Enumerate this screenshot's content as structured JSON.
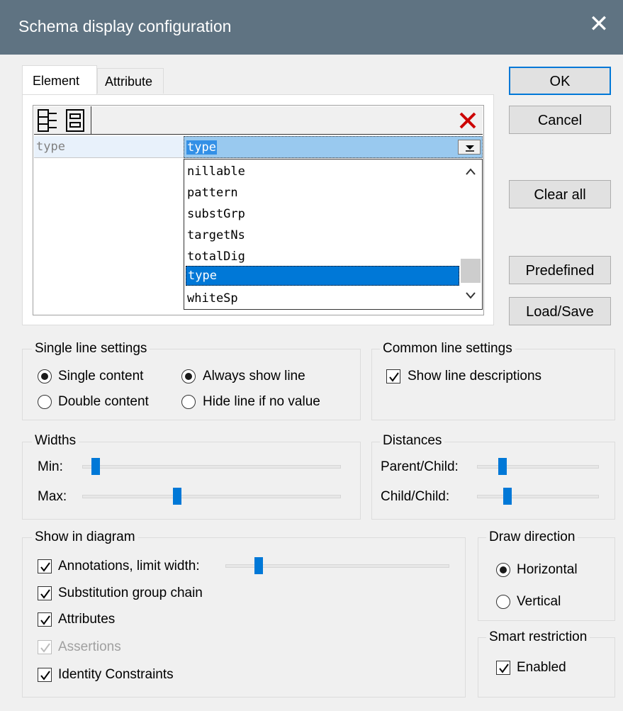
{
  "window": {
    "title": "Schema display configuration",
    "close_glyph": "✕"
  },
  "tabs": [
    {
      "label": "Element",
      "active": true
    },
    {
      "label": "Attribute",
      "active": false
    }
  ],
  "buttons": {
    "ok": "OK",
    "cancel": "Cancel",
    "clear_all": "Clear all",
    "predefined": "Predefined",
    "load_save": "Load/Save"
  },
  "toolbar": {
    "icons": [
      "insert-line-icon",
      "append-line-icon"
    ],
    "delete_icon": "delete-icon",
    "delete_color": "#cc0000"
  },
  "grid": {
    "row_label": "type",
    "combo_value": "type",
    "dropdown_items": [
      "nillable",
      "pattern",
      "substGrp",
      "targetNs",
      "totalDig",
      "type",
      "whiteSp"
    ],
    "selected_index": 5
  },
  "single_line": {
    "title": "Single line settings",
    "single_content": "Single content",
    "double_content": "Double content",
    "always_show": "Always show line",
    "hide_if_no_value": "Hide line if no value"
  },
  "common_line": {
    "title": "Common line settings",
    "show_descriptions": "Show line descriptions"
  },
  "widths": {
    "title": "Widths",
    "min_label": "Min:",
    "max_label": "Max:",
    "min_value": 0.05,
    "max_value": 0.37
  },
  "distances": {
    "title": "Distances",
    "parent_child_label": "Parent/Child:",
    "child_child_label": "Child/Child:",
    "parent_child_value": 0.2,
    "child_child_value": 0.25
  },
  "show_in_diagram": {
    "title": "Show in diagram",
    "annotations": "Annotations, limit width:",
    "annotations_value": 0.06,
    "substitution": "Substitution group chain",
    "attributes": "Attributes",
    "assertions": "Assertions",
    "identity": "Identity Constraints"
  },
  "draw_direction": {
    "title": "Draw direction",
    "horizontal": "Horizontal",
    "vertical": "Vertical"
  },
  "smart_restriction": {
    "title": "Smart restriction",
    "enabled": "Enabled"
  },
  "colors": {
    "accent": "#0078d7",
    "titlebar": "#5f7382",
    "selection": "#0078d7",
    "combo_highlight": "#99c9ef"
  }
}
